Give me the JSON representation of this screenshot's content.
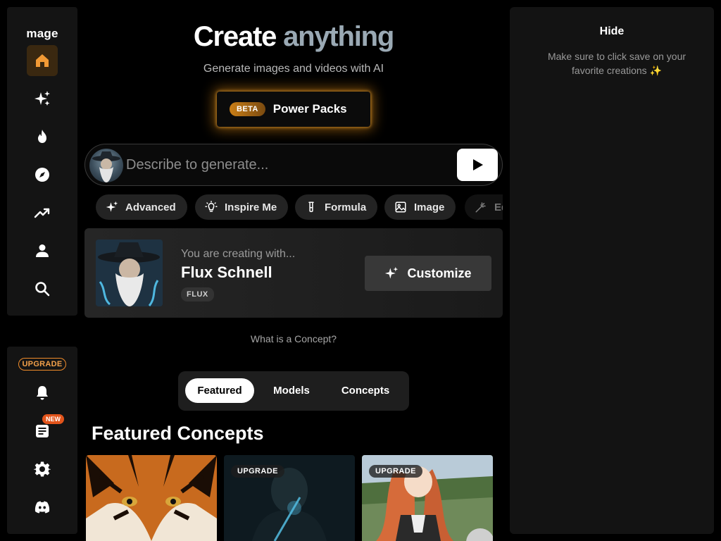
{
  "sidebar": {
    "logo": "mage",
    "nav": [
      "home-icon",
      "sparkles-icon",
      "fire-icon",
      "compass-icon",
      "trending-icon",
      "user-icon",
      "search-icon"
    ],
    "upgrade_label": "UPGRADE",
    "new_badge": "NEW",
    "bottom": [
      "bell-icon",
      "document-icon",
      "settings-icon",
      "discord-icon"
    ],
    "accent_color": "#f08c2a"
  },
  "hero": {
    "title_part1": "Create",
    "title_part2": "anything",
    "subtitle": "Generate images and videos with AI",
    "beta_label": "BETA",
    "power_label": "Power Packs"
  },
  "prompt": {
    "placeholder": "Describe to generate..."
  },
  "chips": [
    {
      "label": "Advanced",
      "icon": "sparkles-icon"
    },
    {
      "label": "Inspire Me",
      "icon": "lightbulb-icon"
    },
    {
      "label": "Formula",
      "icon": "test-tube-icon"
    },
    {
      "label": "Image",
      "icon": "image-icon"
    },
    {
      "label": "Edit",
      "icon": "magic-wand-icon"
    }
  ],
  "model": {
    "creating_label": "You are creating with...",
    "name": "Flux Schnell",
    "tag": "FLUX",
    "customize_label": "Customize"
  },
  "concept_link": "What is a Concept?",
  "tabs": [
    {
      "label": "Featured",
      "active": true
    },
    {
      "label": "Models",
      "active": false
    },
    {
      "label": "Concepts",
      "active": false
    }
  ],
  "featured": {
    "title": "Featured Concepts",
    "cards": [
      {
        "badge": ""
      },
      {
        "badge": "UPGRADE"
      },
      {
        "badge": "UPGRADE"
      }
    ]
  },
  "right_panel": {
    "hide_label": "Hide",
    "note": "Make sure to click save on your favorite creations ✨"
  }
}
